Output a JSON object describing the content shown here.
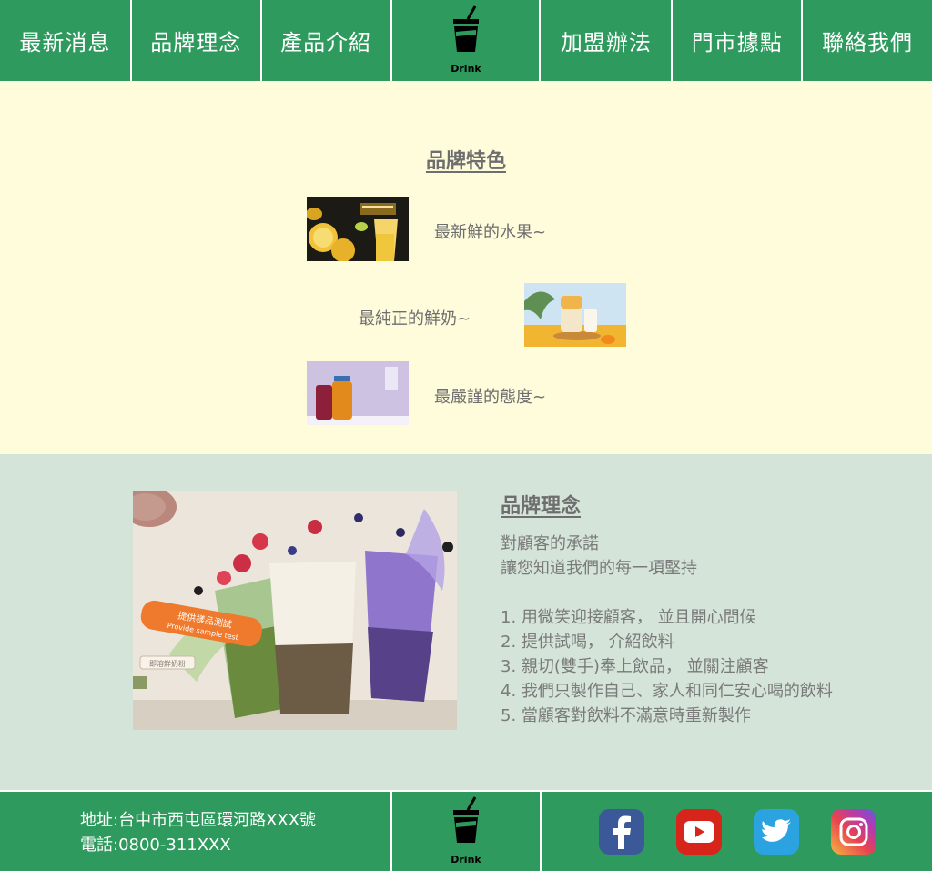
{
  "nav": {
    "left": [
      "最新消息",
      "品牌理念",
      "產品介紹"
    ],
    "right": [
      "加盟辦法",
      "門市據點",
      "聯絡我們"
    ],
    "logo_text": "Drink"
  },
  "features": {
    "title": "品牌特色",
    "items": [
      {
        "text": "最新鮮的水果~",
        "image": "lemon-drink-image"
      },
      {
        "text": "最純正的鮮奶~",
        "image": "milk-tea-image"
      },
      {
        "text": "最嚴謹的態度~",
        "image": "juice-jars-image"
      }
    ]
  },
  "concept": {
    "title": "品牌理念",
    "intro": [
      "對顧客的承諾",
      "讓您知道我們的每一項堅持"
    ],
    "list": [
      "1. 用微笑迎接顧客， 並且開心問候",
      "2. 提供試喝， 介紹飲料",
      "3. 親切(雙手)奉上飲品， 並關注顧客",
      "4. 我們只製作自己、家人和同仁安心喝的飲料",
      "5. 當顧客對飲料不滿意時重新製作"
    ],
    "banner": {
      "label_zh": "提供樣品測試",
      "label_en": "Provide sample test",
      "side_text": "即溶鮮奶粉"
    }
  },
  "footer": {
    "address": "地址:台中市西屯區環河路XXX號",
    "phone": "電話:0800-311XXX",
    "logo_text": "Drink",
    "social": [
      "facebook-icon",
      "youtube-icon",
      "twitter-icon",
      "instagram-icon"
    ]
  },
  "colors": {
    "green": "#2e9a5d",
    "cream": "#fffcdc",
    "mint": "#d4e4d8",
    "text": "#6e6e6e"
  }
}
